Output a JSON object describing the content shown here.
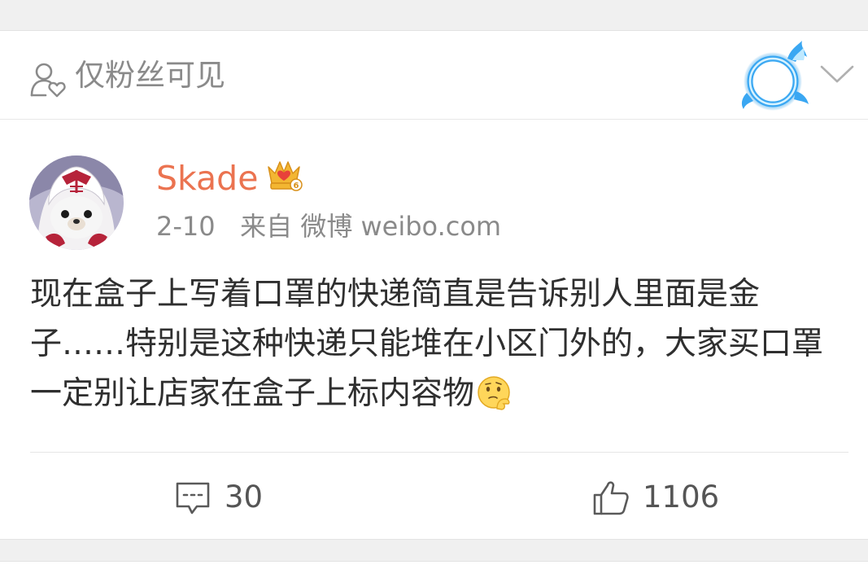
{
  "visibility": {
    "label": "仅粉丝可见",
    "icon": "fans-only-icon"
  },
  "badge": {
    "icon": "blue-flame-ring-badge-icon"
  },
  "menu": {
    "icon": "chevron-down-icon"
  },
  "author": {
    "avatar": "avatar",
    "name": "Skade",
    "vip_icon": "crown-vip-icon",
    "date": "2-10",
    "source": "来自 微博 weibo.com"
  },
  "post": {
    "text": "现在盒子上写着口罩的快递简直是告诉别人里面是金子……特别是这种快递只能堆在小区门外的，大家买口罩一定别让店家在盒子上标内容物",
    "emoji": "thinking-emoji-icon"
  },
  "actions": {
    "comment_count": "30",
    "like_count": "1106"
  },
  "colors": {
    "username": "#eb7350",
    "secondary_text": "#8a8a8a",
    "body_text": "#2f2f2f",
    "background": "#f0f0f0"
  }
}
